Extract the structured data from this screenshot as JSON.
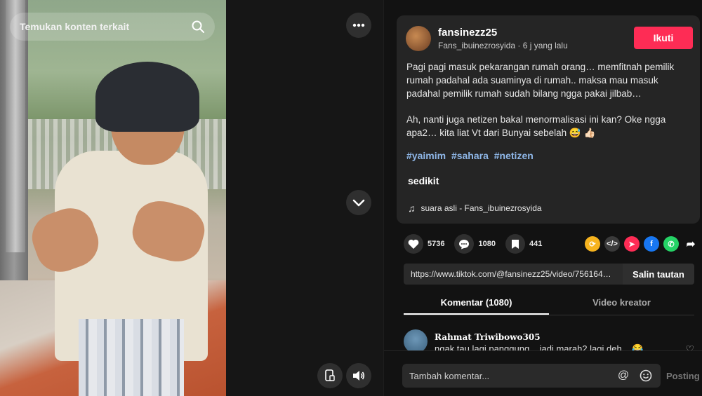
{
  "search": {
    "placeholder": "Temukan konten terkait"
  },
  "post": {
    "author": "fansinezz25",
    "sub": "Fans_ibuinezrosyida · 6 j yang lalu",
    "follow_label": "Ikuti",
    "paragraph1": "Pagi pagi masuk pekarangan rumah orang… memfitnah pemilik rumah padahal ada suaminya di rumah.. maksa mau masuk padahal pemilik rumah sudah bilang ngga pakai jilbab…",
    "paragraph2": "Ah, nanti juga netizen bakal menormalisasi ini kan? Oke ngga apa2… kita liat Vt dari Bunyai sebelah 😅 👍🏻",
    "hashtags": [
      "#yaimim",
      "#sahara",
      "#netizen"
    ],
    "more_label": "sedikit",
    "music": "suara asli - Fans_ibuinezrosyida"
  },
  "stats": {
    "likes": "5736",
    "comments": "1080",
    "saves": "441"
  },
  "share_icons": [
    "repost-icon",
    "embed-icon",
    "send-icon",
    "facebook-icon",
    "whatsapp-icon",
    "share-arrow-icon"
  ],
  "link": {
    "url": "https://www.tiktok.com/@fansinezz25/video/7561641…",
    "copy_label": "Salin tautan"
  },
  "tabs": [
    {
      "label": "Komentar (1080)"
    },
    {
      "label": "Video kreator"
    }
  ],
  "comment": {
    "name": "Rahmat Triwibowo305",
    "text": "ngak tau lagi panggung... jadi marah2 lagi deh... 😂"
  },
  "comment_bar": {
    "placeholder": "Tambah komentar...",
    "post_label": "Posting"
  },
  "colors": {
    "accent": "#fe2c55",
    "hashtag": "#8fb7e8",
    "panel_bg": "#121212",
    "card_bg": "#252525"
  }
}
